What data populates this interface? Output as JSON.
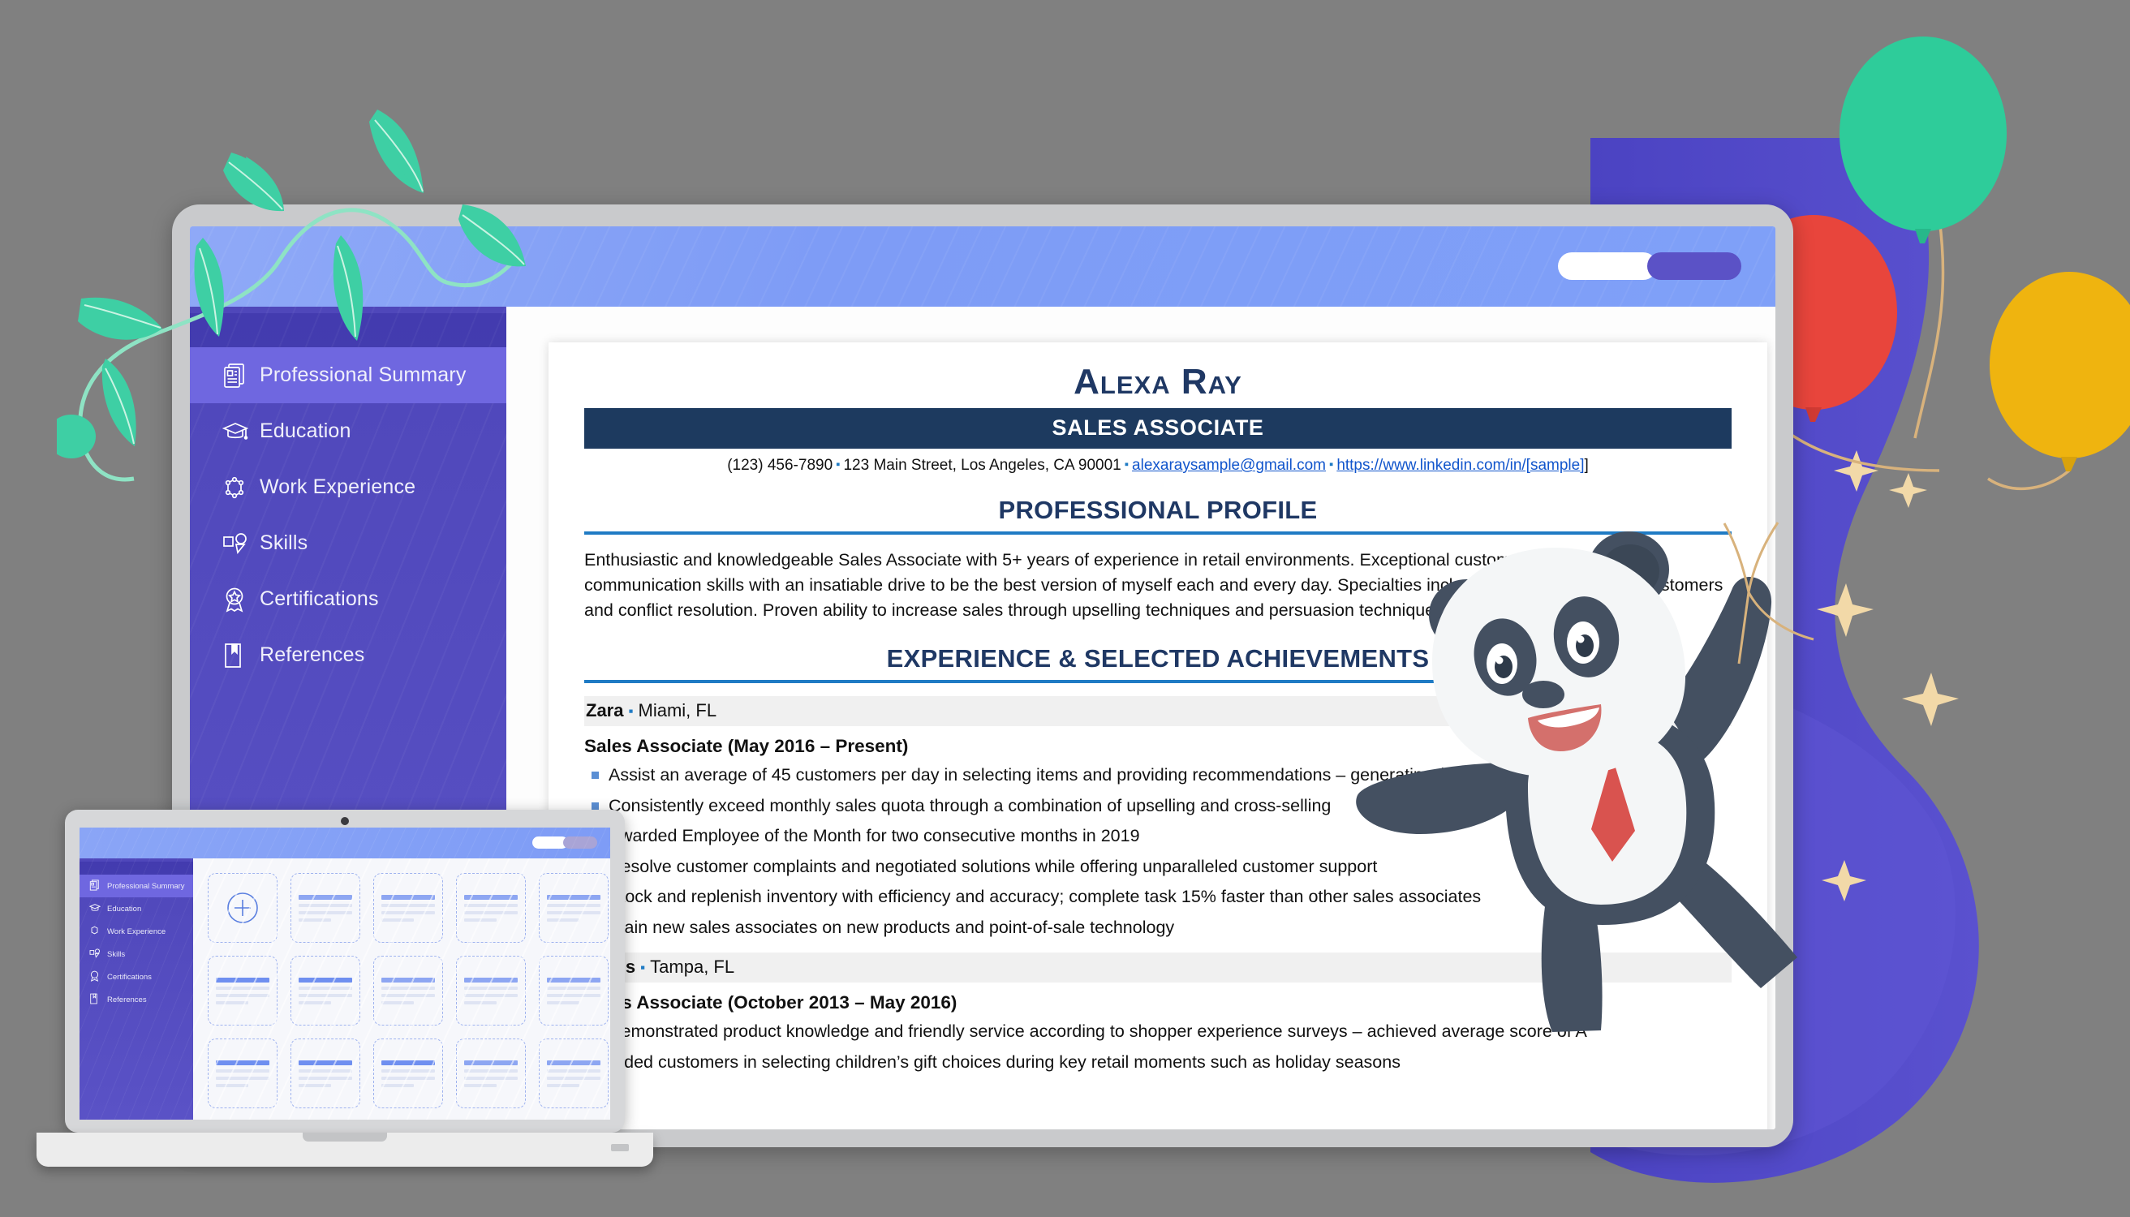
{
  "app": {
    "topbar": {
      "pill_primary_label": "",
      "pill_secondary_label": ""
    },
    "sidebar": {
      "items": [
        {
          "label": "Professional Summary",
          "icon": "document-lines-icon",
          "active": true
        },
        {
          "label": "Education",
          "icon": "graduation-cap-icon",
          "active": false
        },
        {
          "label": "Work Experience",
          "icon": "network-hexagon-icon",
          "active": false
        },
        {
          "label": "Skills",
          "icon": "skills-tag-icon",
          "active": false
        },
        {
          "label": "Certifications",
          "icon": "award-ribbon-icon",
          "active": false
        },
        {
          "label": "References",
          "icon": "bookmark-book-icon",
          "active": false
        }
      ]
    }
  },
  "resume": {
    "name": "Alexa Ray",
    "job_title": "SALES ASSOCIATE",
    "contact": {
      "phone": "(123) 456-7890",
      "address": "123 Main Street, Los Angeles, CA 90001",
      "email": "alexaraysample@gmail.com",
      "linkedin": "https://www.linkedin.com/in/[sample]",
      "linkedin_suffix": "]",
      "separator": "▪"
    },
    "sections": [
      {
        "heading": "PROFESSIONAL PROFILE",
        "paragraph": "Enthusiastic and knowledgeable Sales Associate with 5+ years of experience in retail environments. Exceptional customer service and communication skills with an insatiable drive to be the best version of myself each and every day. Specialties include dealing with difficult customers and conflict resolution. Proven ability to increase sales through upselling techniques and persuasion techniques."
      },
      {
        "heading": "EXPERIENCE & SELECTED ACHIEVEMENTS",
        "jobs": [
          {
            "company": "Zara",
            "location": "Miami, FL",
            "role": "Sales Associate (May 2016 – Present)",
            "bullets": [
              "Assist an average of 45 customers per day in selecting items and providing recommendations – generating $20K in incremental revenue",
              "Consistently exceed monthly sales quota through a combination of upselling and cross-selling",
              "Awarded Employee of the Month for two consecutive months in 2019",
              "Resolve customer complaints and negotiated solutions while offering unparalleled customer support",
              "Stock and replenish inventory with efficiency and accuracy; complete task 15% faster than other sales associates",
              "Train new sales associates on new products and point-of-sale technology"
            ]
          },
          {
            "company": "Kohls",
            "location": "Tampa, FL",
            "role": "Sales Associate (October 2013 – May 2016)",
            "bullets": [
              "Demonstrated product knowledge and friendly service according to shopper experience surveys – achieved average score of A",
              "Aided customers in selecting children’s gift choices during key retail moments such as holiday seasons"
            ]
          }
        ]
      }
    ]
  },
  "preview_laptop": {
    "sidebar_items": [
      "Professional Summary",
      "Education",
      "Work Experience",
      "Skills",
      "Certifications",
      "References"
    ],
    "gallery": {
      "add_card_label": "+",
      "rows": 3,
      "columns": 5
    }
  },
  "decorations": {
    "balloons": [
      {
        "name": "teal-balloon",
        "color": "#2ecc9a"
      },
      {
        "name": "red-balloon",
        "color": "#e8453c"
      },
      {
        "name": "yellow-balloon",
        "color": "#efb40f"
      }
    ],
    "vine": {
      "name": "leaf-vine",
      "color": "#3ed0a5"
    },
    "blob": {
      "name": "purple-blob",
      "color": "#4a42c0"
    },
    "mascot": {
      "name": "panda-mascot",
      "tie_color": "#d9534f"
    }
  },
  "colors": {
    "background": "#808080",
    "sidebar": "#4f47ba",
    "sidebar_active": "#6f67e0",
    "topbar": "#7e9cf6",
    "resume_navy": "#1f3864",
    "resume_bar": "#1d3a5f",
    "resume_rule": "#1f7bc4",
    "link": "#1155cc"
  }
}
